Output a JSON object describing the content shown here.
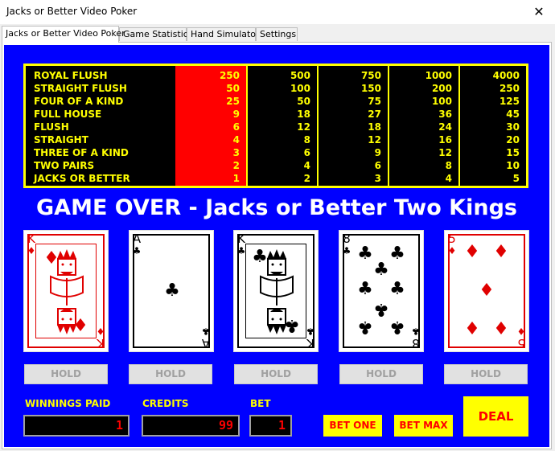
{
  "window": {
    "title": "Jacks or Better Video Poker",
    "close_glyph": "✕"
  },
  "tabs": [
    {
      "label": "Jacks or Better Video Poker",
      "active": true
    },
    {
      "label": "Game Statistics",
      "active": false
    },
    {
      "label": "Hand Simulator",
      "active": false
    },
    {
      "label": "Settings",
      "active": false
    }
  ],
  "paytable": {
    "hands": [
      "ROYAL FLUSH",
      "STRAIGHT FLUSH",
      "FOUR OF A KIND",
      "FULL HOUSE",
      "FLUSH",
      "STRAIGHT",
      "THREE OF A KIND",
      "TWO PAIRS",
      "JACKS OR BETTER"
    ],
    "columns": [
      [
        "250",
        "50",
        "25",
        "9",
        "6",
        "4",
        "3",
        "2",
        "1"
      ],
      [
        "500",
        "100",
        "50",
        "18",
        "12",
        "8",
        "6",
        "4",
        "2"
      ],
      [
        "750",
        "150",
        "75",
        "27",
        "18",
        "12",
        "9",
        "6",
        "3"
      ],
      [
        "1000",
        "200",
        "100",
        "36",
        "24",
        "16",
        "12",
        "8",
        "4"
      ],
      [
        "4000",
        "250",
        "125",
        "45",
        "30",
        "20",
        "15",
        "10",
        "5"
      ]
    ],
    "highlight_column": 0,
    "colors": {
      "text": "#ffff00",
      "highlight": "#ff0000",
      "background": "#000000"
    }
  },
  "result_text": "GAME OVER - Jacks or Better Two Kings",
  "cards": [
    {
      "rank": "K",
      "suit": "♦",
      "color": "red",
      "face_icon": "king-face-icon"
    },
    {
      "rank": "A",
      "suit": "♣",
      "color": "black",
      "face_icon": "ace-pip-icon"
    },
    {
      "rank": "K",
      "suit": "♣",
      "color": "black",
      "face_icon": "king-face-icon"
    },
    {
      "rank": "8",
      "suit": "♣",
      "color": "black",
      "face_icon": "eight-pips-icon"
    },
    {
      "rank": "5",
      "suit": "♦",
      "color": "red",
      "face_icon": "five-pips-icon"
    }
  ],
  "hold_label": "HOLD",
  "labels": {
    "winnings": "WINNINGS PAID",
    "credits": "CREDITS",
    "bet": "BET"
  },
  "values": {
    "winnings": "1",
    "credits": "99",
    "bet": "1"
  },
  "buttons": {
    "bet_one": "BET ONE",
    "bet_max": "BET MAX",
    "deal": "DEAL"
  },
  "colors": {
    "table_bg": "#0000ff",
    "accent": "#ffff00",
    "display_text": "#ff0000"
  }
}
